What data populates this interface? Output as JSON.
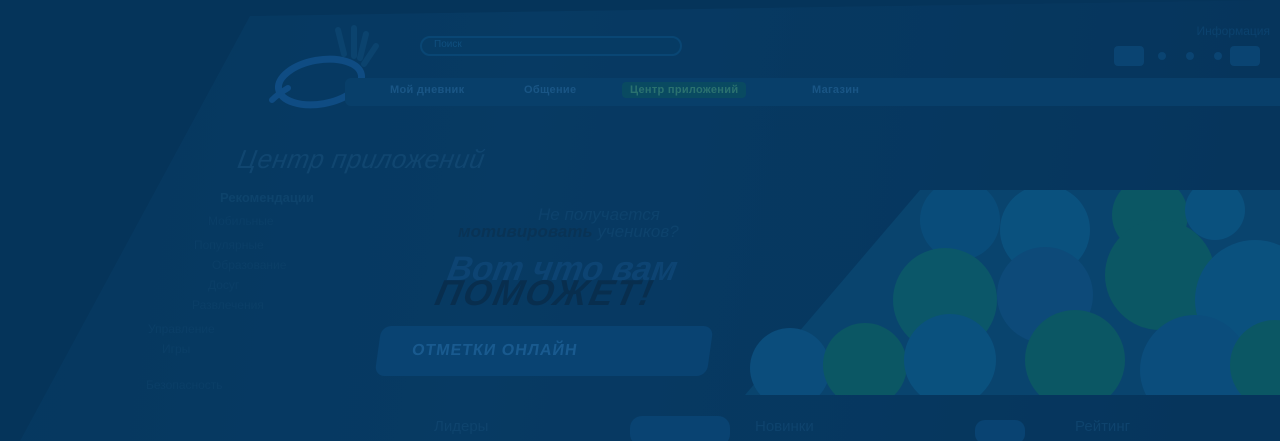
{
  "search": {
    "placeholder": "Поиск"
  },
  "header": {
    "top_right": "Информация"
  },
  "nav": [
    {
      "label": "Мой дневник"
    },
    {
      "label": "Общение"
    },
    {
      "label": "Центр приложений"
    },
    {
      "label": "Магазин"
    }
  ],
  "page": {
    "title": "Центр приложений"
  },
  "sidebar": {
    "heading": "Рекомендации",
    "items": [
      "Мобильные",
      "Популярные",
      "Образование",
      "Досуг",
      "Развлечения",
      "Управление",
      "Игры",
      "Безопасность"
    ]
  },
  "promo": {
    "line1": "Не получается",
    "line2_bold": "мотивировать",
    "line2_rest": "учеников?",
    "line3": "Вот что вам",
    "line4": "ПОМОЖЕТ!",
    "cta_label": "ОТМЕТКИ ОНЛАЙН"
  },
  "bottom": [
    "Лидеры",
    "Новинки",
    "Рейтинг"
  ],
  "colors": {
    "overlay": "#05345a",
    "accent": "#0d5b63"
  }
}
